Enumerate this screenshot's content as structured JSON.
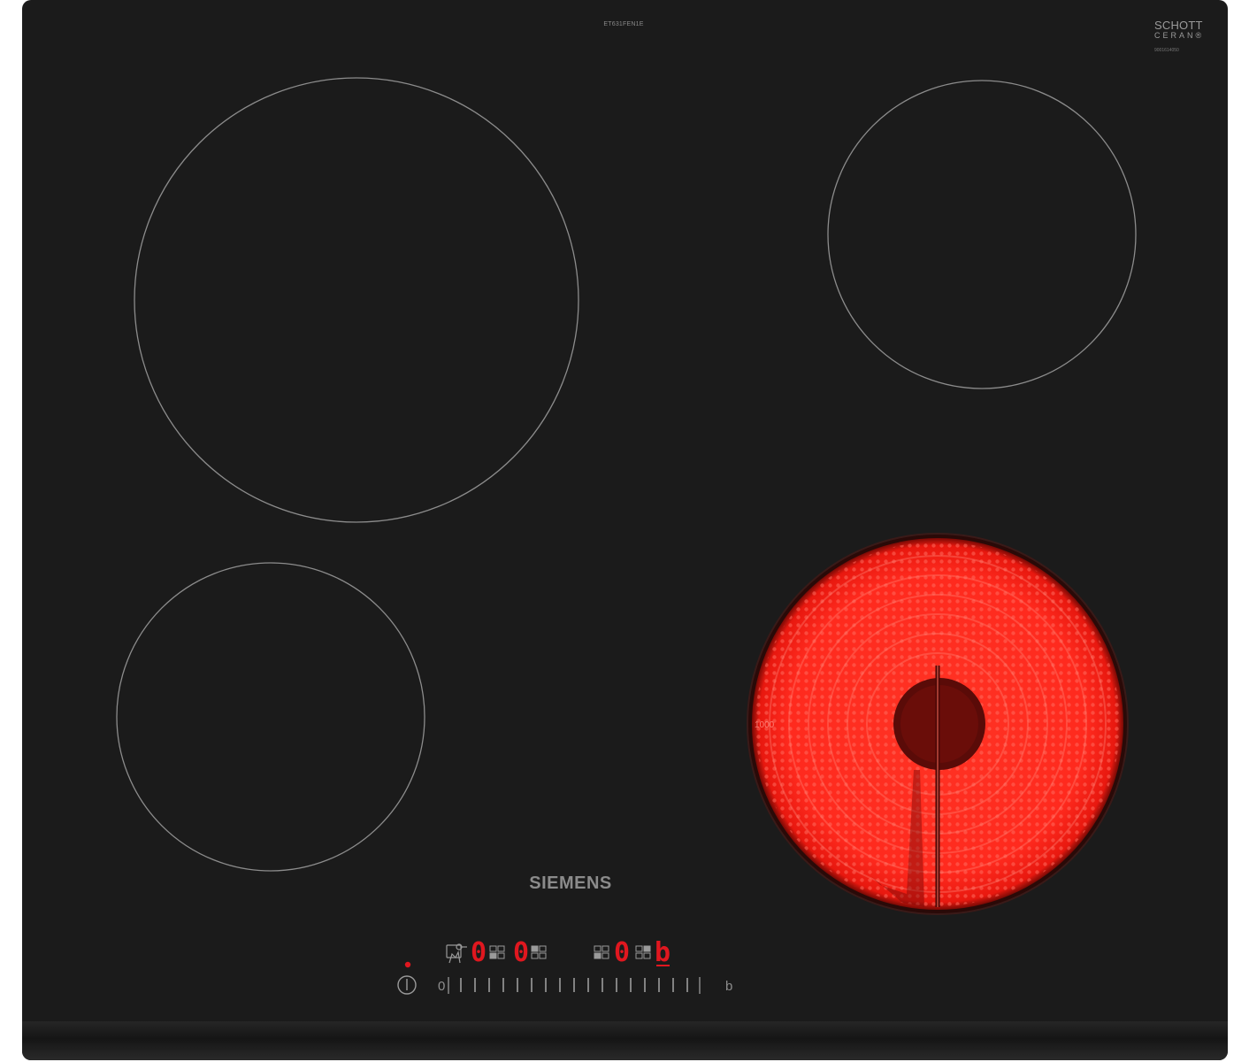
{
  "model_number": "ET631FEN1E",
  "glass_brand": {
    "line1": "SCHOTT",
    "line2": "CERAN",
    "registered_mark": "®"
  },
  "cert_number": "9001614050",
  "brand": "SIEMENS",
  "zone_label": "1000",
  "control_panel": {
    "zone_displays": [
      "0",
      "0",
      "0",
      "b"
    ],
    "slider_min_label": "0",
    "slider_max_label": "b",
    "slider_tick_count": 17
  },
  "colors": {
    "glass": "#1b1b1b",
    "zone_outline": "#8c8c8c",
    "heating_glow": "#ff2a1e",
    "display_red": "#e0171f",
    "print_gray": "#8b8b8b"
  },
  "icons": [
    "power-icon",
    "child-lock-icon",
    "zone-position-icon"
  ]
}
